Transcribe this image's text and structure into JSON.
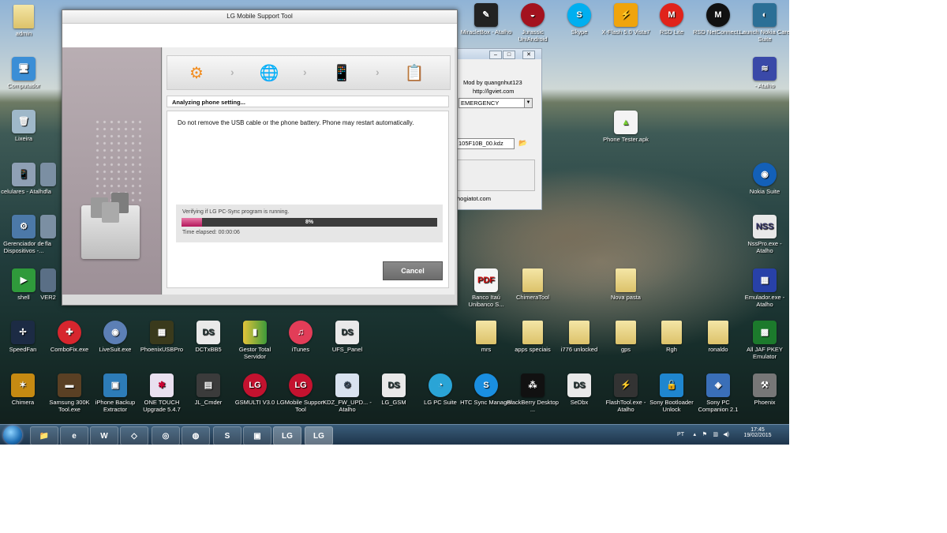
{
  "colors": {
    "progress_fill": "#c42a6b",
    "cancel_button": "#777777",
    "lg_red": "#c4122f",
    "taskbar": "#243b52"
  },
  "lg_window": {
    "title": "LG Mobile Support Tool",
    "steps": [
      {
        "icon": "gear-icon",
        "active": true
      },
      {
        "icon": "globe-icon",
        "active": false
      },
      {
        "icon": "phone-download-icon",
        "active": false
      },
      {
        "icon": "clipboard-check-icon",
        "active": false
      }
    ],
    "status": "Analyzing phone setting...",
    "message": "Do not remove the USB cable or the phone battery. Phone may restart automatically.",
    "progress_text": "Verifying if LG PC-Sync program is running.",
    "progress_percent": 8,
    "progress_label": "8%",
    "elapsed": "Time elapsed: 00:00:06",
    "cancel_label": "Cancel"
  },
  "bg_window": {
    "mod_line": "Mod by quangnhut123",
    "url": "http://lgviet.com",
    "select_value": "EMERGENCY",
    "file_value": "105F10B_00.kdz",
    "footer": "hogiatot.com"
  },
  "desktop_icons": [
    {
      "label": "admin",
      "icon": "user-folder-icon"
    },
    {
      "label": "Computador",
      "icon": "computer-icon"
    },
    {
      "label": "Lixeira",
      "icon": "recycle-bin-icon"
    },
    {
      "label": "celulares - Atalho",
      "icon": "phone-shortcut-icon"
    },
    {
      "label": "Gerenciador de Dispositivos -...",
      "icon": "device-manager-icon"
    },
    {
      "label": "shell",
      "icon": "shell-icon"
    },
    {
      "label": "fla",
      "icon": "flash-icon"
    },
    {
      "label": "fla",
      "icon": "flash-icon"
    },
    {
      "label": "VER2",
      "icon": "ver-icon"
    },
    {
      "label": "SpeedFan",
      "icon": "speedfan-icon"
    },
    {
      "label": "ComboFix.exe",
      "icon": "combofix-icon"
    },
    {
      "label": "LiveSuit.exe",
      "icon": "livesuit-icon"
    },
    {
      "label": "PhoenixUSBPro",
      "icon": "phoenix-usb-icon"
    },
    {
      "label": "DCTxBB5",
      "icon": "dct-icon"
    },
    {
      "label": "Gestor Total Servidor",
      "icon": "gestor-icon"
    },
    {
      "label": "iTunes",
      "icon": "itunes-icon"
    },
    {
      "label": "UFS_Panel",
      "icon": "ufs-icon"
    },
    {
      "label": "Chimera",
      "icon": "chimera-icon"
    },
    {
      "label": "Samsung 300K Tool.exe",
      "icon": "samsung-tool-icon"
    },
    {
      "label": "iPhone Backup Extractor",
      "icon": "iphone-backup-icon"
    },
    {
      "label": "ONE TOUCH Upgrade 5.4.7",
      "icon": "onetouch-icon"
    },
    {
      "label": "JL_Cmder",
      "icon": "jl-cmder-icon"
    },
    {
      "label": "GSMULTI V3.0",
      "icon": "lg-icon"
    },
    {
      "label": "LGMobile Support Tool",
      "icon": "lg-icon"
    },
    {
      "label": "KDZ_FW_UPD... - Atalho",
      "icon": "kdz-icon"
    },
    {
      "label": "LG_GSM",
      "icon": "lg-gsm-icon"
    },
    {
      "label": "LG PC Suite",
      "icon": "lg-pc-suite-icon"
    },
    {
      "label": "HTC Sync Manager",
      "icon": "htc-sync-icon"
    },
    {
      "label": "BlackBerry Desktop ...",
      "icon": "blackberry-icon"
    },
    {
      "label": "SeDbx",
      "icon": "sedbx-icon"
    },
    {
      "label": "FlashTool.exe - Atalho",
      "icon": "flashtool-icon"
    },
    {
      "label": "Sony Bootloader Unlock",
      "icon": "lock-icon"
    },
    {
      "label": "Sony PC Companion 2.1",
      "icon": "sony-pc-icon"
    },
    {
      "label": "Phoenix",
      "icon": "phoenix-icon"
    },
    {
      "label": "MiracleBox - Atalho",
      "icon": "miracle-icon"
    },
    {
      "label": "Jurassic UniAndroid",
      "icon": "jurassic-icon"
    },
    {
      "label": "Skype",
      "icon": "skype-icon"
    },
    {
      "label": "X-Flash 5.0 Vista7",
      "icon": "xflash-icon"
    },
    {
      "label": "RSD Lite",
      "icon": "motorola-icon"
    },
    {
      "label": "RSD NetConnect...",
      "icon": "motorola-icon"
    },
    {
      "label": "Launch Nokia Care Suite",
      "icon": "nokia-care-icon"
    },
    {
      "label": "- Atalho",
      "icon": "nokia-shortcut-icon"
    },
    {
      "label": "Nokia Suite",
      "icon": "nokia-suite-icon"
    },
    {
      "label": "NssPro.exe - Atalho",
      "icon": "nss-icon"
    },
    {
      "label": "Emulador.exe - Atalho",
      "icon": "emulador-icon"
    },
    {
      "label": "All JAF PKEY Emulator",
      "icon": "jaf-icon"
    },
    {
      "label": "Phone Tester.apk",
      "icon": "android-apk-icon"
    },
    {
      "label": "Banco Itaú Unibanco S...",
      "icon": "pdf-icon"
    },
    {
      "label": "ChimeraTool",
      "icon": "folder-icon"
    },
    {
      "label": "Nova pasta",
      "icon": "folder-icon"
    },
    {
      "label": "mrs",
      "icon": "folder-icon"
    },
    {
      "label": "apps speciais",
      "icon": "folder-icon"
    },
    {
      "label": "i776 unlocked",
      "icon": "folder-icon"
    },
    {
      "label": "gps",
      "icon": "folder-icon"
    },
    {
      "label": "Rgh",
      "icon": "folder-icon"
    },
    {
      "label": "ronaldo",
      "icon": "folder-icon"
    }
  ],
  "taskbar": {
    "apps": [
      {
        "icon": "explorer-icon"
      },
      {
        "icon": "ie-icon"
      },
      {
        "icon": "word-icon"
      },
      {
        "icon": "files-icon"
      },
      {
        "icon": "chrome-icon"
      },
      {
        "icon": "firefox-icon"
      },
      {
        "icon": "skype-icon"
      },
      {
        "icon": "toolbox-icon"
      },
      {
        "icon": "lg-icon"
      },
      {
        "icon": "lg-icon"
      }
    ],
    "language": "PT",
    "time": "17:45",
    "date": "19/02/2015"
  }
}
